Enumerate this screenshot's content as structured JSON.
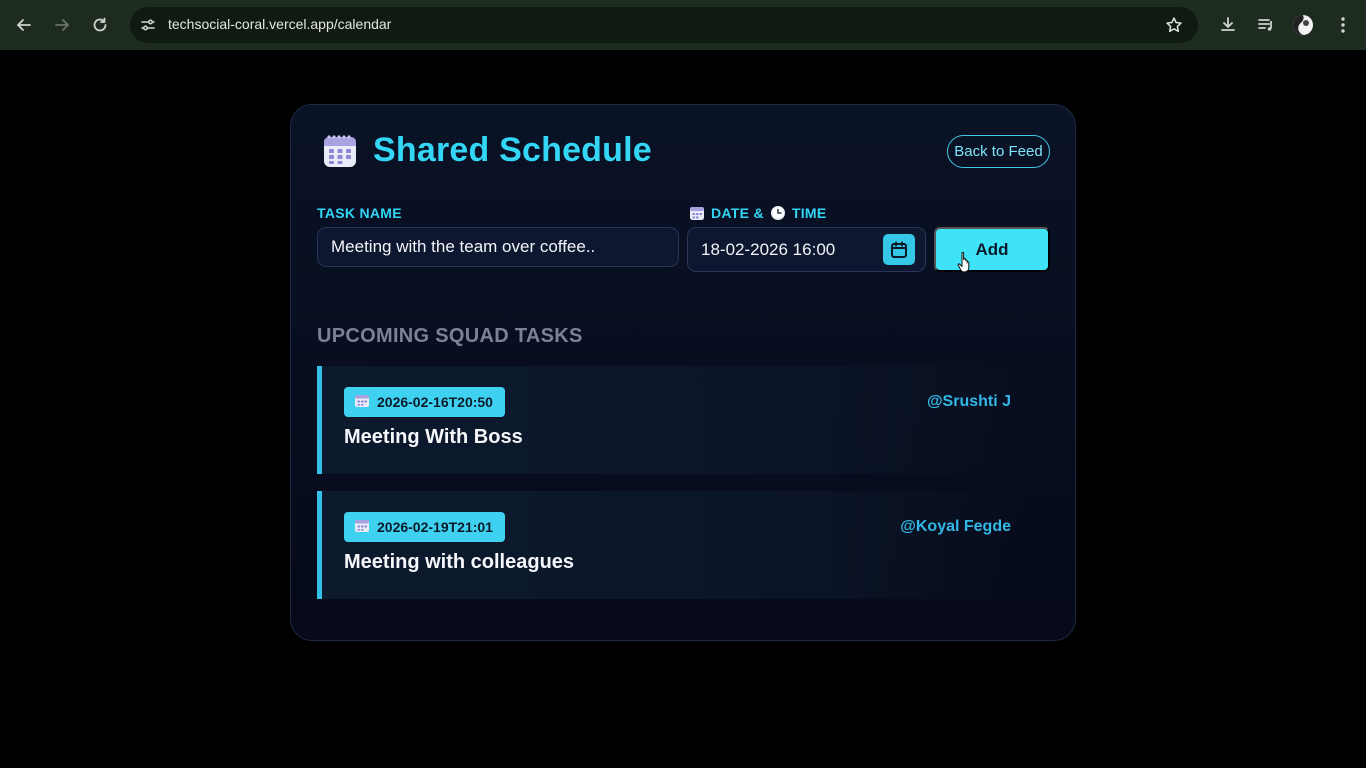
{
  "browser": {
    "url": "techsocial-coral.vercel.app/calendar"
  },
  "header": {
    "title": "Shared Schedule",
    "back_label": "Back to Feed"
  },
  "form": {
    "task_label": "TASK NAME",
    "date_label_part1": "DATE &",
    "date_label_part2": "TIME",
    "task_value": "Meeting with the team over coffee..",
    "date_value": "18-02-2026 16:00",
    "add_label": "Add"
  },
  "upcoming": {
    "title": "UPCOMING SQUAD TASKS",
    "tasks": [
      {
        "datetime": "2026-02-16T20:50",
        "name": "Meeting With Boss",
        "user": "@Srushti J"
      },
      {
        "datetime": "2026-02-19T21:01",
        "name": "Meeting with colleagues",
        "user": "@Koyal Fegde"
      }
    ]
  },
  "colors": {
    "accent": "#33d6f5",
    "add_button": "#3fe3f7",
    "card_bg": "#0a1226",
    "page_bg": "#000000"
  },
  "icons": [
    "back-arrow-icon",
    "forward-arrow-icon",
    "reload-icon",
    "site-settings-icon",
    "star-icon",
    "download-icon",
    "media-icon",
    "profile-icon",
    "menu-icon",
    "calendar-icon",
    "clock-icon"
  ]
}
